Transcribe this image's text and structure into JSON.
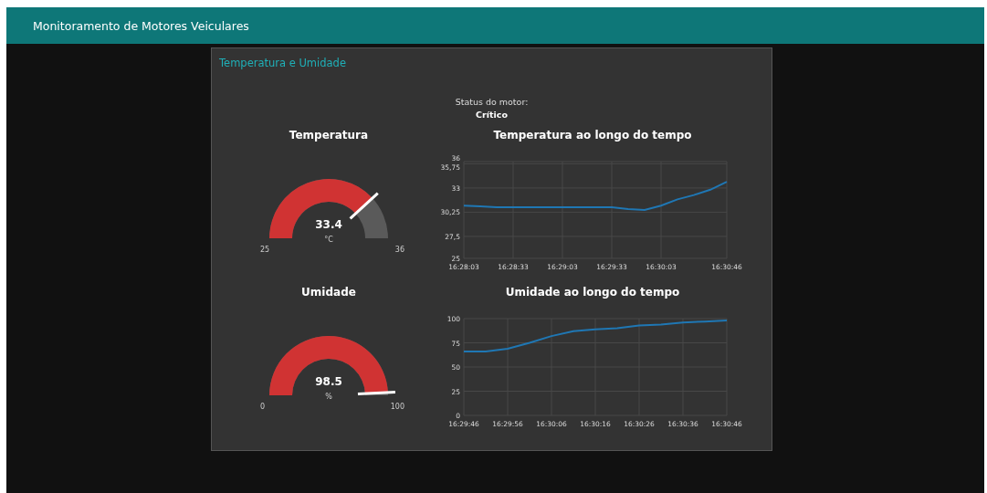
{
  "header": {
    "title": "Monitoramento de Motores Veiculares"
  },
  "card": {
    "title": "Temperatura e Umidade",
    "status": {
      "label": "Status do motor:",
      "value": "Crítico"
    },
    "rows": [
      {
        "gauge": {
          "title": "Temperatura",
          "value": "33.4",
          "unit": "°C",
          "min": "25",
          "max": "36"
        },
        "chart": {
          "chart_data": {
            "type": "line",
            "title": "Temperatura ao longo do tempo",
            "categories": [
              "16:28:03",
              null,
              null,
              "16:28:33",
              null,
              null,
              "16:29:03",
              null,
              null,
              "16:29:33",
              null,
              null,
              "16:30:03",
              null,
              null,
              null,
              "16:30:46"
            ],
            "grid": true,
            "series": [
              {
                "color": "#1f77b4",
                "values": [
                  31,
                  30.9,
                  30.8,
                  30.8,
                  30.8,
                  30.8,
                  30.8,
                  30.8,
                  30.8,
                  30.8,
                  30.6,
                  30.5,
                  31.0,
                  31.7,
                  32.2,
                  32.8,
                  33.7
                ]
              }
            ],
            "ylim": [
              25,
              36
            ],
            "yticks": [
              25,
              {
                "value": 27.5,
                "label": "27,5"
              },
              {
                "value": 30.25,
                "label": "30,25"
              },
              33,
              {
                "value": 35.75,
                "label": "35,75"
              },
              36
            ]
          }
        }
      },
      {
        "gauge": {
          "title": "Umidade",
          "value": "98.5",
          "unit": "%",
          "min": "0",
          "max": "100"
        },
        "chart": {
          "chart_data": {
            "type": "line",
            "title": "Umidade ao longo do tempo",
            "categories": [
              "16:29:46",
              null,
              "16:29:56",
              null,
              "16:30:06",
              null,
              "16:30:16",
              null,
              "16:30:26",
              null,
              "16:30:36",
              null,
              "16:30:46"
            ],
            "series": [
              {
                "color": "#1f77b4",
                "values": [
                  66,
                  66,
                  69,
                  75,
                  82,
                  87,
                  89,
                  90,
                  93,
                  94,
                  96,
                  97,
                  98
                ]
              }
            ],
            "grid": true,
            "ylim": [
              0,
              100
            ],
            "yticks": [
              0,
              25,
              50,
              75,
              100
            ]
          }
        }
      }
    ]
  }
}
